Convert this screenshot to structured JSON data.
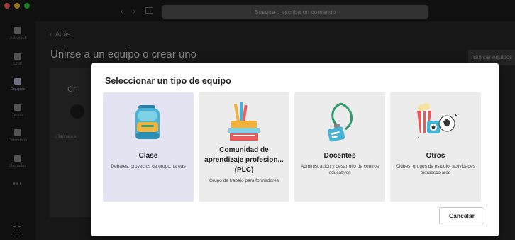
{
  "titlebar": {
    "search_placeholder": "Busque o escriba un comando"
  },
  "rail": {
    "items": [
      {
        "label": "Actividad",
        "icon": "bell-icon"
      },
      {
        "label": "Chat",
        "icon": "chat-icon"
      },
      {
        "label": "Equipos",
        "icon": "teams-icon"
      },
      {
        "label": "Tareas",
        "icon": "assignments-icon"
      },
      {
        "label": "Calendario",
        "icon": "calendar-icon"
      },
      {
        "label": "Llamadas",
        "icon": "phone-icon"
      }
    ],
    "more": "•••"
  },
  "page": {
    "back_label": "Atrás",
    "title": "Unirse a un equipo o crear uno",
    "search_teams_label": "Buscar equipos",
    "bg_card_title": "Cr",
    "bg_card_sub": "¡Reúna a s"
  },
  "modal": {
    "title": "Seleccionar un tipo de equipo",
    "cards": [
      {
        "title": "Clase",
        "description": "Debates, proyectos de grupo, tareas",
        "illustration": "backpack-icon"
      },
      {
        "title": "Comunidad de aprendizaje profesion... (PLC)",
        "description": "Grupo de trabajo para formadores",
        "illustration": "books-pencils-icon"
      },
      {
        "title": "Docentes",
        "description": "Administración y desarrollo de centros educativos",
        "illustration": "lanyard-badge-icon"
      },
      {
        "title": "Otros",
        "description": "Clubes, grupos de estudio, actividades extraescolares",
        "illustration": "popcorn-ball-icon"
      }
    ],
    "cancel_label": "Cancelar"
  },
  "colors": {
    "accent": "#6264a7",
    "selected_card": "#e3e3f2",
    "card_bg": "#ececec"
  }
}
